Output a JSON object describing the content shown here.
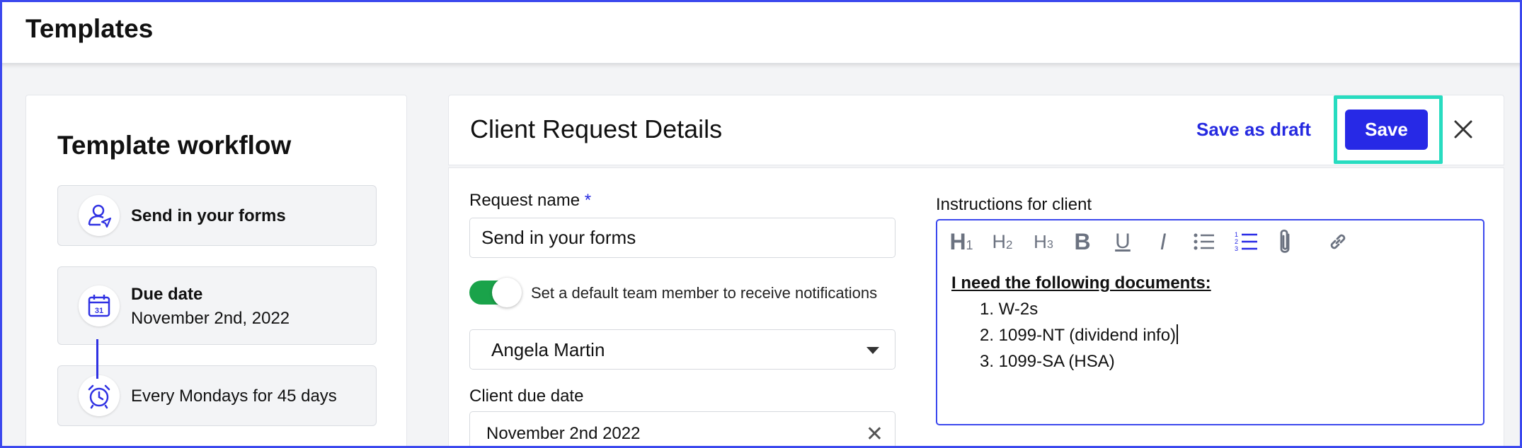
{
  "topbar": {
    "title": "Templates"
  },
  "workflow": {
    "title": "Template workflow",
    "steps": [
      {
        "label": "Send in your forms",
        "icon": "user-send-icon"
      },
      {
        "title": "Due date",
        "subtitle": "November 2nd, 2022",
        "icon": "calendar-icon",
        "calendar_day": "31"
      },
      {
        "label": "Every Mondays for 45 days",
        "icon": "alarm-clock-icon"
      }
    ]
  },
  "header": {
    "title": "Client Request Details",
    "save_draft_label": "Save as draft",
    "save_label": "Save",
    "close_icon": "close-icon"
  },
  "form": {
    "request_name_label": "Request name",
    "required_mark": "*",
    "request_name_value": "Send in your forms",
    "toggle_on": true,
    "toggle_label": "Set a default team member to receive notifications",
    "team_member_value": "Angela Martin",
    "due_date_label": "Client due date",
    "due_date_value": "November 2nd 2022"
  },
  "instructions": {
    "label": "Instructions for client",
    "toolbar": [
      {
        "name": "heading-1-icon",
        "text": "H1"
      },
      {
        "name": "heading-2-icon",
        "text": "H2"
      },
      {
        "name": "heading-3-icon",
        "text": "H3"
      },
      {
        "name": "bold-icon",
        "text": "B"
      },
      {
        "name": "underline-icon",
        "text": "U"
      },
      {
        "name": "italic-icon",
        "text": "I"
      },
      {
        "name": "bullet-list-icon"
      },
      {
        "name": "numbered-list-icon",
        "active": true
      },
      {
        "name": "attachment-icon"
      },
      {
        "name": "link-icon"
      }
    ],
    "heading": "I need the following documents:",
    "items": [
      "1. W-2s",
      "2. 1099-NT (dividend info)",
      "3. 1099-SA (HSA)"
    ]
  },
  "colors": {
    "accent": "#2729e6",
    "highlight": "#27dcc0",
    "toggle_on": "#1aa34a",
    "frame": "#3b48ee"
  }
}
